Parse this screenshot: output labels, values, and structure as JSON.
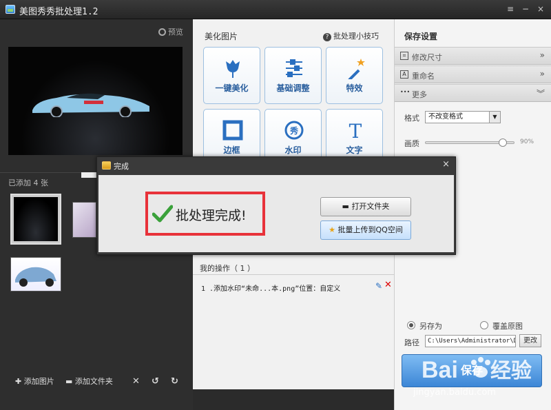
{
  "window": {
    "title": "美图秀秀批处理1.2",
    "menu_icon": "≡",
    "minimize_icon": "−",
    "close_icon": "×"
  },
  "left": {
    "preview_label": "预览",
    "added_label": "已添加 4 张",
    "add_image": "添加图片",
    "add_folder": "添加文件夹"
  },
  "middle": {
    "header": "美化图片",
    "tips": "批处理小技巧",
    "tools": [
      {
        "label": "一键美化",
        "icon": "tulip-icon"
      },
      {
        "label": "基础调整",
        "icon": "sliders-icon"
      },
      {
        "label": "特效",
        "icon": "magic-wand-icon"
      },
      {
        "label": "边框",
        "icon": "frame-icon"
      },
      {
        "label": "水印",
        "icon": "watermark-icon"
      },
      {
        "label": "文字",
        "icon": "text-icon"
      }
    ],
    "ops_header": "我的操作（ 1 ）",
    "op_item": "1 .添加水印“未命...本.png”位置：自定义"
  },
  "right": {
    "header": "保存设置",
    "sections": [
      "修改尺寸",
      "重命名",
      "更多"
    ],
    "format_label": "格式",
    "format_value": "不改变格式",
    "quality_label": "画质",
    "quality_value": "90%",
    "quality_fraction": 0.9,
    "save_as": "另存为",
    "overwrite": "覆盖原图",
    "path_label": "路径",
    "path_value": "C:\\Users\\Administrator\\De:",
    "change_btn": "更改",
    "save_btn": "保存"
  },
  "dialog": {
    "title": "完成",
    "message": "批处理完成!",
    "open_folder": "打开文件夹",
    "upload_qq": "批量上传到QQ空间"
  },
  "watermark": {
    "site": "jingyan.baidu.com",
    "logo": "Baidu经验"
  }
}
